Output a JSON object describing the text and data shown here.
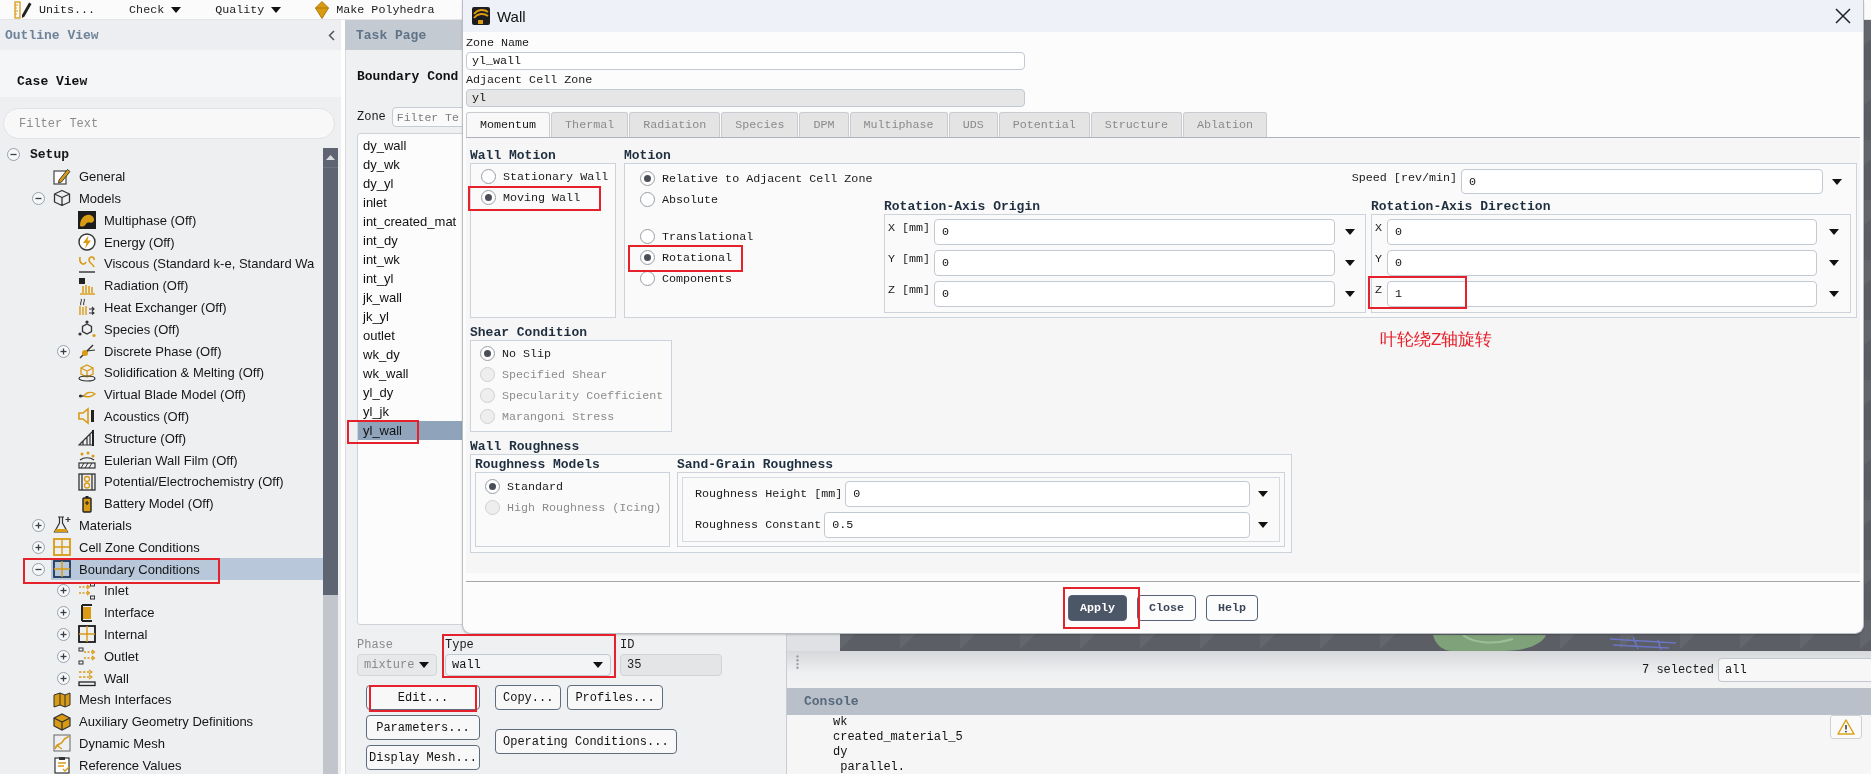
{
  "toolbar": {
    "items": [
      {
        "kind": "button",
        "label": "Units..."
      },
      {
        "kind": "menu",
        "label": "Check"
      },
      {
        "kind": "menu",
        "label": "Quality"
      },
      {
        "kind": "button",
        "label": "Make Polyhedra"
      }
    ]
  },
  "outline": {
    "title": "Outline View",
    "case_view": "Case View",
    "filter_placeholder": "Filter Text",
    "tree": [
      {
        "label": "Setup",
        "expanded": true,
        "selected": false,
        "marked": false,
        "children": [
          {
            "label": "General",
            "selected": false,
            "marked": false
          },
          {
            "label": "Models",
            "expanded": true,
            "selected": false,
            "marked": false,
            "children": [
              {
                "label": "Multiphase (Off)",
                "selected": false,
                "marked": false
              },
              {
                "label": "Energy (Off)",
                "selected": false,
                "marked": false
              },
              {
                "label": "Viscous (Standard k-e, Standard Wa",
                "selected": false,
                "marked": false
              },
              {
                "label": "Radiation (Off)",
                "selected": false,
                "marked": false
              },
              {
                "label": "Heat Exchanger (Off)",
                "selected": false,
                "marked": false
              },
              {
                "label": "Species (Off)",
                "selected": false,
                "marked": false
              },
              {
                "label": "Discrete Phase (Off)",
                "expanded": false,
                "selected": false,
                "marked": false
              },
              {
                "label": "Solidification & Melting (Off)",
                "selected": false,
                "marked": false
              },
              {
                "label": "Virtual Blade Model (Off)",
                "selected": false,
                "marked": false
              },
              {
                "label": "Acoustics (Off)",
                "selected": false,
                "marked": false
              },
              {
                "label": "Structure (Off)",
                "selected": false,
                "marked": false
              },
              {
                "label": "Eulerian Wall Film (Off)",
                "selected": false,
                "marked": false
              },
              {
                "label": "Potential/Electrochemistry (Off)",
                "selected": false,
                "marked": false
              },
              {
                "label": "Battery Model (Off)",
                "selected": false,
                "marked": false
              }
            ]
          },
          {
            "label": "Materials",
            "expanded": false,
            "selected": false,
            "marked": false
          },
          {
            "label": "Cell Zone Conditions",
            "expanded": false,
            "selected": false,
            "marked": false
          },
          {
            "label": "Boundary Conditions",
            "expanded": true,
            "selected": true,
            "marked": true,
            "children": [
              {
                "label": "Inlet",
                "expanded": false,
                "selected": false,
                "marked": false
              },
              {
                "label": "Interface",
                "expanded": false,
                "selected": false,
                "marked": false
              },
              {
                "label": "Internal",
                "expanded": false,
                "selected": false,
                "marked": false
              },
              {
                "label": "Outlet",
                "expanded": false,
                "selected": false,
                "marked": false
              },
              {
                "label": "Wall",
                "expanded": false,
                "selected": false,
                "marked": false
              }
            ]
          },
          {
            "label": "Mesh Interfaces",
            "selected": false,
            "marked": false
          },
          {
            "label": "Auxiliary Geometry Definitions",
            "selected": false,
            "marked": false
          },
          {
            "label": "Dynamic Mesh",
            "selected": false,
            "marked": false
          },
          {
            "label": "Reference Values",
            "selected": false,
            "marked": false
          }
        ]
      }
    ]
  },
  "task_page": {
    "title": "Task Page",
    "heading": "Boundary Cond",
    "zone_label": "Zone",
    "zone_filter_placeholder": "Filter Te",
    "zones": [
      {
        "name": "dy_wall",
        "selected": false,
        "marked": false
      },
      {
        "name": "dy_wk",
        "selected": false,
        "marked": false
      },
      {
        "name": "dy_yl",
        "selected": false,
        "marked": false
      },
      {
        "name": "inlet",
        "selected": false,
        "marked": false
      },
      {
        "name": "int_created_mat",
        "selected": false,
        "marked": false
      },
      {
        "name": "int_dy",
        "selected": false,
        "marked": false
      },
      {
        "name": "int_wk",
        "selected": false,
        "marked": false
      },
      {
        "name": "int_yl",
        "selected": false,
        "marked": false
      },
      {
        "name": "jk_wall",
        "selected": false,
        "marked": false
      },
      {
        "name": "jk_yl",
        "selected": false,
        "marked": false
      },
      {
        "name": "outlet",
        "selected": false,
        "marked": false
      },
      {
        "name": "wk_dy",
        "selected": false,
        "marked": false
      },
      {
        "name": "wk_wall",
        "selected": false,
        "marked": false
      },
      {
        "name": "yl_dy",
        "selected": false,
        "marked": false
      },
      {
        "name": "yl_jk",
        "selected": false,
        "marked": false
      },
      {
        "name": "yl_wall",
        "selected": true,
        "marked": true
      }
    ],
    "phase": {
      "label": "Phase",
      "value": "mixture",
      "disabled": true
    },
    "type": {
      "label": "Type",
      "value": "wall",
      "marked": true
    },
    "id": {
      "label": "ID",
      "value": "35"
    },
    "buttons_left": [
      {
        "label": "Edit...",
        "marked": true
      },
      {
        "label": "Parameters...",
        "marked": false
      },
      {
        "label": "Display Mesh...",
        "marked": false
      }
    ],
    "buttons_right": [
      {
        "label": "Copy...",
        "marked": false
      },
      {
        "label": "Profiles...",
        "marked": false
      },
      {
        "label": "Operating Conditions...",
        "marked": false
      }
    ]
  },
  "dialog": {
    "title": "Wall",
    "zone_name": {
      "label": "Zone Name",
      "value": "yl_wall"
    },
    "adjacent_cell_zone": {
      "label": "Adjacent Cell Zone",
      "value": "yl",
      "disabled": true
    },
    "tabs": [
      {
        "label": "Momentum",
        "selected": true
      },
      {
        "label": "Thermal",
        "selected": false
      },
      {
        "label": "Radiation",
        "selected": false
      },
      {
        "label": "Species",
        "selected": false
      },
      {
        "label": "DPM",
        "selected": false
      },
      {
        "label": "Multiphase",
        "selected": false
      },
      {
        "label": "UDS",
        "selected": false
      },
      {
        "label": "Potential",
        "selected": false
      },
      {
        "label": "Structure",
        "selected": false
      },
      {
        "label": "Ablation",
        "selected": false
      }
    ],
    "wall_motion": {
      "title": "Wall Motion",
      "options": [
        {
          "label": "Stationary Wall",
          "selected": false,
          "marked": false
        },
        {
          "label": "Moving Wall",
          "selected": true,
          "marked": true
        }
      ]
    },
    "motion": {
      "title": "Motion",
      "reference": [
        {
          "label": "Relative to Adjacent Cell Zone",
          "selected": true
        },
        {
          "label": "Absolute",
          "selected": false
        }
      ],
      "type": [
        {
          "label": "Translational",
          "selected": false,
          "marked": false
        },
        {
          "label": "Rotational",
          "selected": true,
          "marked": true
        },
        {
          "label": "Components",
          "selected": false,
          "marked": false
        }
      ],
      "speed": {
        "label": "Speed [rev/min]",
        "value": "0"
      },
      "axis_origin": {
        "title": "Rotation-Axis Origin",
        "fields": [
          {
            "label": "X [mm]",
            "value": "0"
          },
          {
            "label": "Y [mm]",
            "value": "0"
          },
          {
            "label": "Z [mm]",
            "value": "0"
          }
        ]
      },
      "axis_direction": {
        "title": "Rotation-Axis Direction",
        "fields": [
          {
            "label": "X",
            "value": "0",
            "marked": false
          },
          {
            "label": "Y",
            "value": "0",
            "marked": false
          },
          {
            "label": "Z",
            "value": "1",
            "marked": true
          }
        ]
      }
    },
    "annotation_note": "叶轮绕Z轴旋转",
    "shear_condition": {
      "title": "Shear Condition",
      "options": [
        {
          "label": "No Slip",
          "selected": true,
          "disabled": false
        },
        {
          "label": "Specified Shear",
          "selected": false,
          "disabled": true
        },
        {
          "label": "Specularity Coefficient",
          "selected": false,
          "disabled": true
        },
        {
          "label": "Marangoni Stress",
          "selected": false,
          "disabled": true
        }
      ]
    },
    "wall_roughness": {
      "title": "Wall Roughness",
      "models": {
        "title": "Roughness Models",
        "options": [
          {
            "label": "Standard",
            "selected": true,
            "disabled": false
          },
          {
            "label": "High Roughness (Icing)",
            "selected": false,
            "disabled": true
          }
        ]
      },
      "sand_grain": {
        "title": "Sand-Grain Roughness",
        "fields": [
          {
            "label": "Roughness Height [mm]",
            "value": "0"
          },
          {
            "label": "Roughness Constant",
            "value": "0.5"
          }
        ]
      }
    },
    "buttons": [
      {
        "label": "Apply",
        "kind": "primary",
        "marked": true
      },
      {
        "label": "Close",
        "kind": "default",
        "marked": false
      },
      {
        "label": "Help",
        "kind": "default",
        "marked": false
      }
    ]
  },
  "graphics": {
    "selection_count": "7 selected",
    "selection_filter": "all"
  },
  "console": {
    "title": "Console",
    "lines": [
      "wk",
      "created_material_5",
      "dy",
      " parallel."
    ]
  }
}
